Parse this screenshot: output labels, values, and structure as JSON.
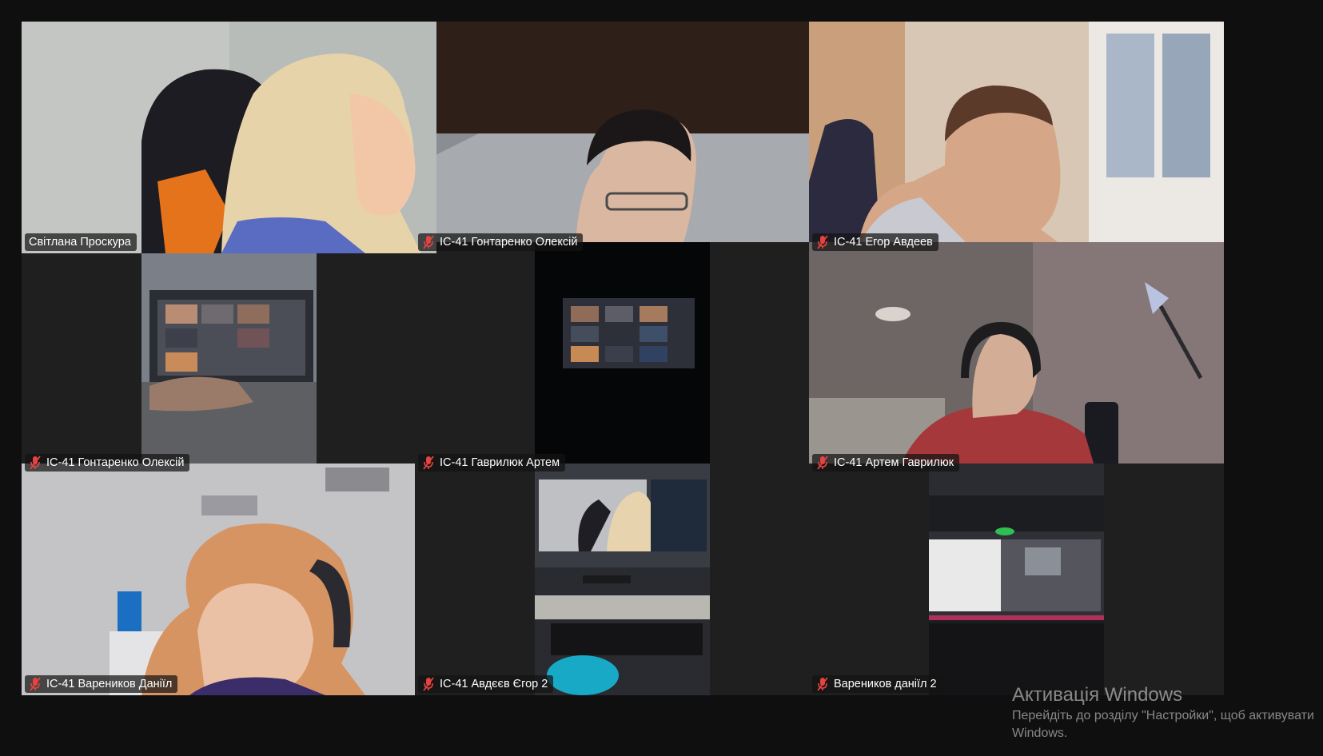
{
  "meeting": {
    "tiles": [
      {
        "name": "Світлана Проскура",
        "muted": false,
        "speaking": true
      },
      {
        "name": "ІС-41 Гонтаренко Олексій",
        "muted": true,
        "speaking": false
      },
      {
        "name": "ІС-41 Егор Авдеев",
        "muted": true,
        "speaking": false
      },
      {
        "name": "ІС-41 Гонтаренко Олексій",
        "muted": true,
        "speaking": false
      },
      {
        "name": "ІС-41 Гаврилюк Артем",
        "muted": true,
        "speaking": false
      },
      {
        "name": "ІС-41 Артем Гаврилюк",
        "muted": true,
        "speaking": false
      },
      {
        "name": "ІС-41 Вареников Даніїл",
        "muted": true,
        "speaking": false
      },
      {
        "name": "ІС-41 Авдєєв Єгор 2",
        "muted": true,
        "speaking": false
      },
      {
        "name": "Вареников даніїл 2",
        "muted": true,
        "speaking": false
      }
    ]
  },
  "colors": {
    "active_speaker": "#1ec98a",
    "muted_icon": "#e8423f",
    "background": "#0f0f0f",
    "tile": "#1f1f1f"
  },
  "icons": {
    "muted": "mic-off-icon"
  },
  "watermark": {
    "title": "Активація Windows",
    "line1": "Перейдіть до розділу \"Настройки\", щоб активувати",
    "line2": "Windows."
  }
}
